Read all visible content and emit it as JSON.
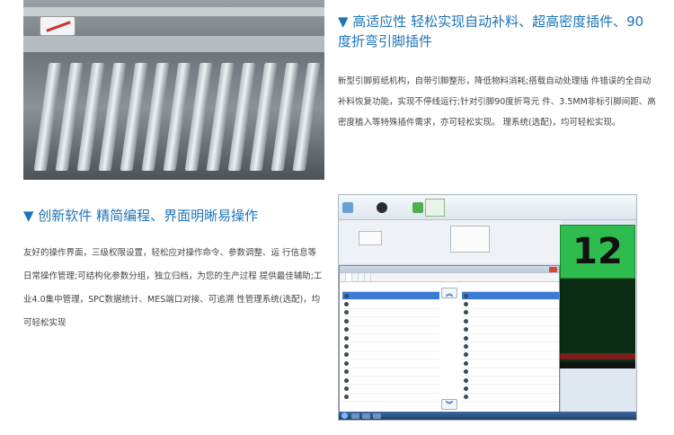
{
  "feature1": {
    "title": "▼ 高适应性   轻松实现自动补料、超高密度插件、90度折弯引脚插件",
    "body": "新型引脚剪纸机构，自带引脚整形，降低物料消耗;搭载自动处理插 件错误的全自动补料恢复功能，实现不停线运行;针对引脚90度折弯元 件、3.5MM非标引脚间距、高密度植入等特殊插件需求，亦可轻松实现。 理系统(选配)，均可轻松实现。"
  },
  "feature2": {
    "title": "▼ 创新软件   精简编程、界面明晰易操作",
    "body": "友好的操作界面，三级权限设置，轻松应对操作命令、参数调整、运 行信息等日常操作管理;可结构化参数分组，独立归档，为您的生产过程 提供最佳辅助;工业4.0集中管理，SPC数据统计、MES端口对接、可追溯 性管理系统(选配)，均可轻松实现"
  },
  "software": {
    "counter": "12"
  },
  "colors": {
    "title_blue": "#1d73b8",
    "counter_green": "#2fbc4f"
  }
}
